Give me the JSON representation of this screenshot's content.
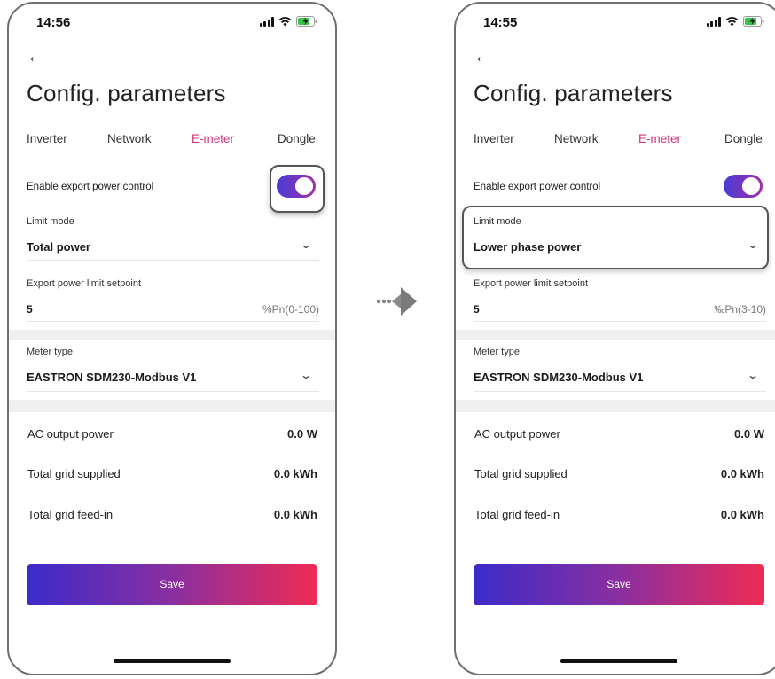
{
  "screens": [
    {
      "time": "14:56",
      "back_glyph": "←",
      "title": "Config. parameters",
      "tabs": [
        "Inverter",
        "Network",
        "E-meter",
        "Dongle"
      ],
      "active_tab": "E-meter",
      "export_control": {
        "label": "Enable export power control",
        "enabled": true
      },
      "limit_mode": {
        "label": "Limit mode",
        "value": "Total power"
      },
      "export_limit": {
        "label": "Export power limit setpoint",
        "value": "5",
        "unit_hint": "%Pn(0-100)"
      },
      "meter_type": {
        "label": "Meter type",
        "value": "EASTRON SDM230-Modbus V1"
      },
      "stats": [
        {
          "label": "AC output power",
          "value": "0.0 W"
        },
        {
          "label": "Total grid supplied",
          "value": "0.0 kWh"
        },
        {
          "label": "Total grid feed-in",
          "value": "0.0 kWh"
        }
      ],
      "save_label": "Save",
      "highlight": "export-power-toggle"
    },
    {
      "time": "14:55",
      "back_glyph": "←",
      "title": "Config. parameters",
      "tabs": [
        "Inverter",
        "Network",
        "E-meter",
        "Dongle"
      ],
      "active_tab": "E-meter",
      "export_control": {
        "label": "Enable export power control",
        "enabled": true
      },
      "limit_mode": {
        "label": "Limit mode",
        "value": "Lower phase power"
      },
      "export_limit": {
        "label": "Export power limit setpoint",
        "value": "5",
        "unit_hint": "‰Pn(3-10)"
      },
      "meter_type": {
        "label": "Meter type",
        "value": "EASTRON SDM230-Modbus V1"
      },
      "stats": [
        {
          "label": "AC output power",
          "value": "0.0 W"
        },
        {
          "label": "Total grid supplied",
          "value": "0.0 kWh"
        },
        {
          "label": "Total grid feed-in",
          "value": "0.0 kWh"
        }
      ],
      "save_label": "Save",
      "highlight": "limit-mode-selector"
    }
  ],
  "icons": {
    "signal": "signal-icon",
    "wifi": "wifi-icon",
    "battery": "battery-charging-icon",
    "back": "back-arrow-icon",
    "dropdown": "chevron-down-icon",
    "flow": "flow-arrow-icon"
  },
  "colors": {
    "active_tab": "#d0357a",
    "toggle_on_start": "#4a3bd6",
    "toggle_on_end": "#a02fa8",
    "save_start": "#3b2bc9",
    "save_end": "#ef2b54",
    "battery": "#3cc24a"
  }
}
